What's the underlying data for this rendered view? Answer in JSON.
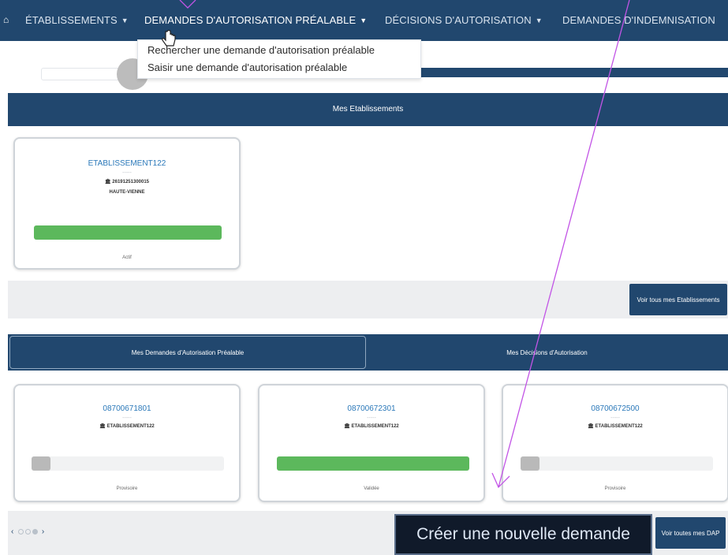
{
  "nav": {
    "items": [
      {
        "label": "ÉTABLISSEMENTS",
        "caret": "▼"
      },
      {
        "label": "DEMANDES D'AUTORISATION PRÉALABLE",
        "caret": "▼"
      },
      {
        "label": "DÉCISIONS D'AUTORISATION",
        "caret": "▼"
      },
      {
        "label": "DEMANDES D'INDEMNISATION",
        "caret": ""
      }
    ],
    "home_icon": "⌂"
  },
  "dropdown": {
    "items": [
      {
        "label": "Rechercher une demande d'autorisation préalable"
      },
      {
        "label": "Saisir une demande d'autorisation préalable"
      }
    ]
  },
  "etablissements": {
    "header": "Mes Etablissements",
    "card": {
      "name": "ETABLISSEMENT122",
      "dash": "-----",
      "siret": "26191251300015",
      "region": "HAUTE-VIENNE",
      "status": "Actif",
      "progress": 1.0,
      "bar_color": "#5cb85c"
    },
    "button": "Voir tous mes Etablissements"
  },
  "tabs": {
    "dap": "Mes Demandes d'Autorisation Préalable",
    "decisions": "Mes Décisions d'Autorisation"
  },
  "dap_cards": [
    {
      "number": "08700671801",
      "dash": "-----",
      "etab": "ETABLISSEMENT122",
      "status": "Provisoire",
      "progress": 0.1,
      "bar_color": "#b9b9b9"
    },
    {
      "number": "08700672301",
      "dash": "-----",
      "etab": "ETABLISSEMENT122",
      "status": "Validée",
      "progress": 1.0,
      "bar_color": "#5cb85c"
    },
    {
      "number": "08700672500",
      "dash": "-----",
      "etab": "ETABLISSEMENT122",
      "status": "Provisoire",
      "progress": 0.1,
      "bar_color": "#b9b9b9"
    }
  ],
  "footer": {
    "prev": "‹",
    "next": "›",
    "create_button": "Créer une nouvelle demande",
    "dap_button": "Voir toutes mes DAP"
  },
  "colors": {
    "primary": "#21476e",
    "link": "#2a78b9",
    "annotation": "#c254e6"
  }
}
